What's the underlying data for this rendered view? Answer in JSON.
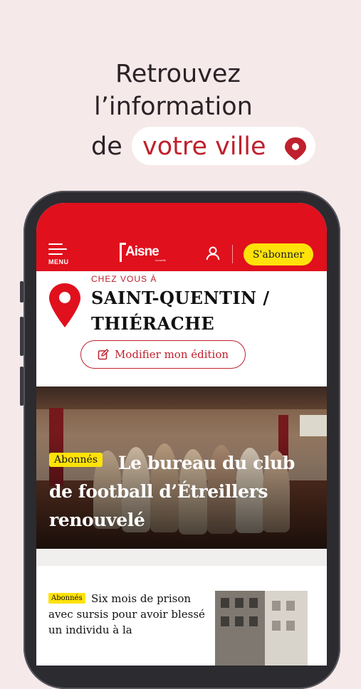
{
  "headline": {
    "line1": "Retrouvez",
    "line2": "l’information",
    "line3_prefix": "de",
    "line3_highlight": "votre ville"
  },
  "app": {
    "menu_label": "MENU",
    "logo_text": "Aisne",
    "logo_subtext": "nouvelle",
    "subscribe_label": "S'abonner"
  },
  "edition": {
    "kicker": "CHEZ VOUS À",
    "city_line1": "SAINT-QUENTIN /",
    "city_line2": "THIÉRACHE",
    "modify_label": "Modifier mon édition"
  },
  "hero": {
    "badge": "Abonnés",
    "title": "Le bureau du club de football d’Étreillers renouvelé"
  },
  "articles": [
    {
      "badge": "Abonnés",
      "title": "Six mois de prison avec sursis pour avoir blessé un individu à la"
    }
  ],
  "colors": {
    "brand_red": "#e0101d",
    "accent_red": "#c0202d",
    "badge_yellow": "#ffe20a",
    "background": "#f6e9ea"
  }
}
